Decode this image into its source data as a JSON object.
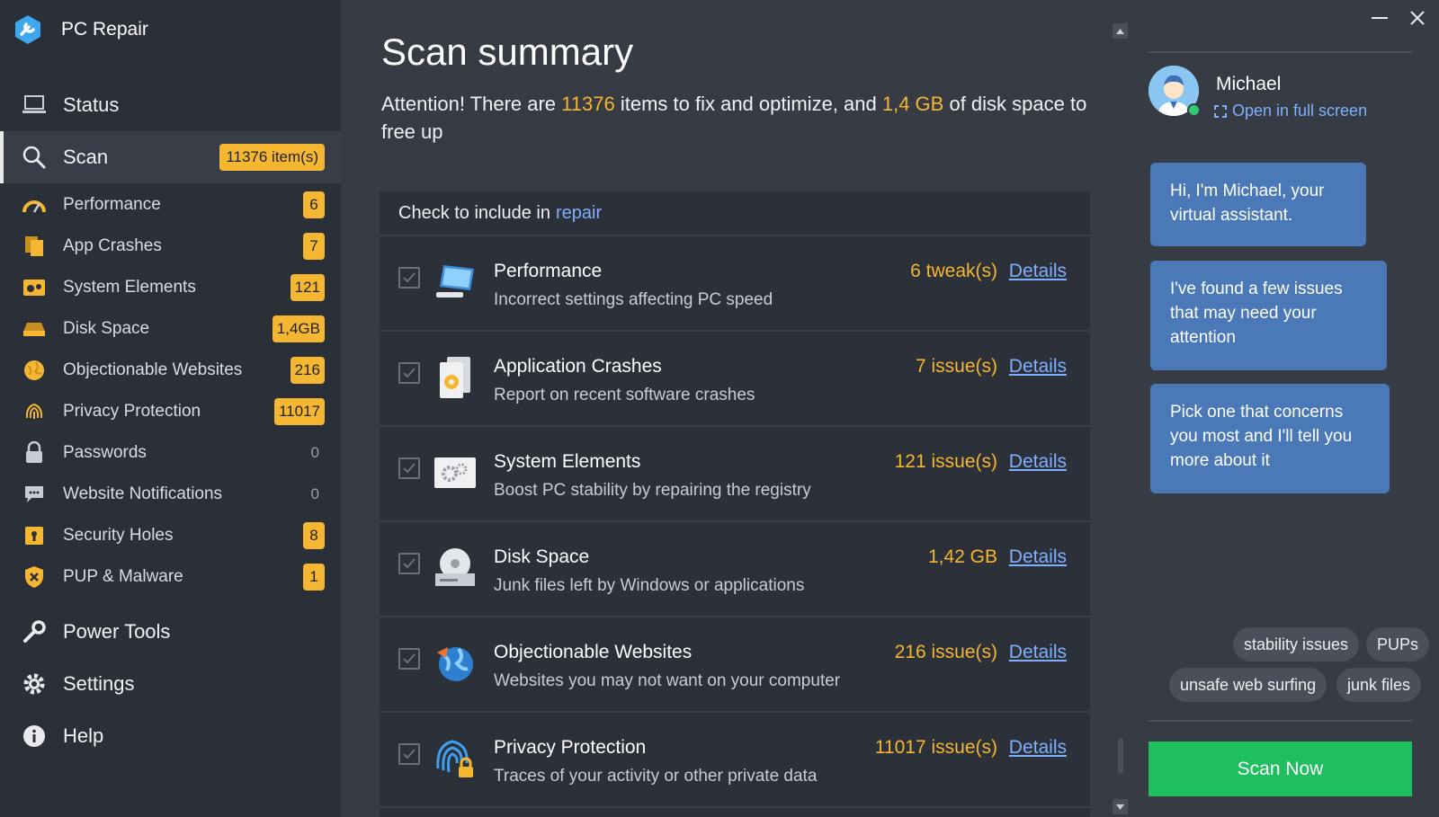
{
  "app": {
    "name": "PC Repair"
  },
  "sidebar": {
    "main_items": [
      {
        "label": "Status"
      },
      {
        "label": "Scan",
        "badge": "11376 item(s)"
      },
      {
        "label": "Power Tools"
      },
      {
        "label": "Settings"
      },
      {
        "label": "Help"
      }
    ],
    "sub_items": [
      {
        "label": "Performance",
        "value": "6"
      },
      {
        "label": "App Crashes",
        "value": "7"
      },
      {
        "label": "System Elements",
        "value": "121"
      },
      {
        "label": "Disk Space",
        "value": "1,4GB"
      },
      {
        "label": "Objectionable Websites",
        "value": "216"
      },
      {
        "label": "Privacy Protection",
        "value": "11017"
      },
      {
        "label": "Passwords",
        "value": "0"
      },
      {
        "label": "Website Notifications",
        "value": "0"
      },
      {
        "label": "Security Holes",
        "value": "8"
      },
      {
        "label": "PUP & Malware",
        "value": "1"
      }
    ]
  },
  "main": {
    "title": "Scan summary",
    "attention": {
      "prefix": "Attention! There are ",
      "items": "11376",
      "middle": " items to fix and optimize, and ",
      "space": "1,4 GB",
      "suffix": " of disk  space to free up"
    },
    "panel_head": {
      "text": "Check to include in",
      "link": "repair"
    },
    "rows": [
      {
        "title": "Performance",
        "subtitle": "Incorrect settings affecting PC speed",
        "count": "6 tweak(s)",
        "details": "Details",
        "icon": "monitor-icon"
      },
      {
        "title": "Application Crashes",
        "subtitle": "Report on recent software crashes",
        "count": "7 issue(s)",
        "details": "Details",
        "icon": "app-crash-icon"
      },
      {
        "title": "System Elements",
        "subtitle": "Boost PC stability by repairing the registry",
        "count": "121 issue(s)",
        "details": "Details",
        "icon": "gears-icon"
      },
      {
        "title": "Disk Space",
        "subtitle": "Junk files left by Windows or applications",
        "count": "1,42 GB",
        "details": "Details",
        "icon": "disk-icon"
      },
      {
        "title": "Objectionable Websites",
        "subtitle": "Websites you may not want on your computer",
        "count": "216 issue(s)",
        "details": "Details",
        "icon": "globe-icon"
      },
      {
        "title": "Privacy Protection",
        "subtitle": "Traces of your activity or other private data",
        "count": "11017 issue(s)",
        "details": "Details",
        "icon": "fingerprint-lock-icon"
      }
    ]
  },
  "assistant": {
    "name": "Michael",
    "fullscreen": "Open in full screen",
    "messages": [
      "Hi, I'm Michael, your virtual assistant.",
      "I've found a few issues that may need your attention",
      "Pick one that concerns you most and I'll tell you more about it"
    ],
    "chips": [
      "stability issues",
      "PUPs",
      "unsafe web surfing",
      "junk files"
    ],
    "scan_button": "Scan Now"
  },
  "colors": {
    "accent": "#f5b731",
    "link": "#7fb0ff",
    "bubble": "#4b79b8",
    "scan_button": "#1fbe5e",
    "sidebar_bg": "#2b2f37",
    "main_bg": "#363b44"
  }
}
